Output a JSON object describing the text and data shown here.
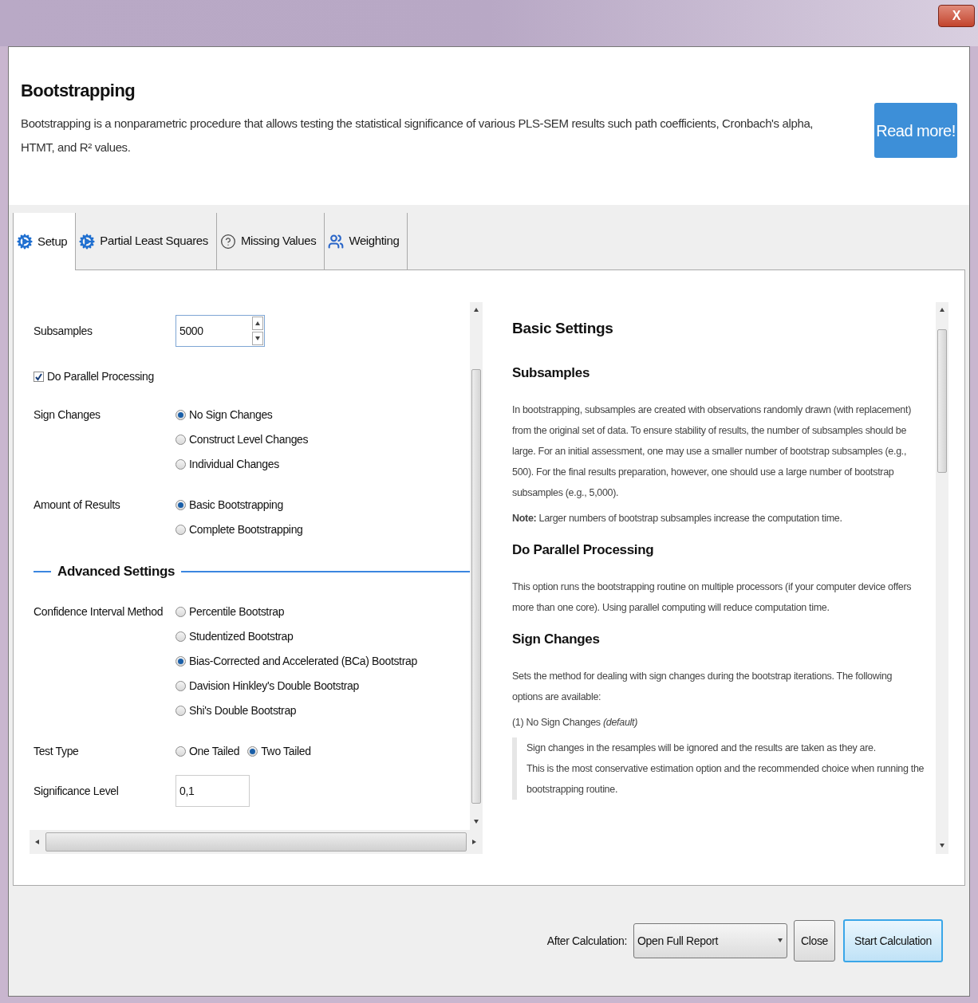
{
  "window": {
    "close_label": "X"
  },
  "header": {
    "title": "Bootstrapping",
    "description": "Bootstrapping is a nonparametric procedure that allows testing the statistical significance of various PLS-SEM results such path coefficients, Cronbach's alpha, HTMT, and R² values.",
    "read_more": "Read more!"
  },
  "tabs": [
    {
      "label": "Setup",
      "kind": "gear",
      "selected": true
    },
    {
      "label": "Partial Least Squares",
      "kind": "gear",
      "selected": false
    },
    {
      "label": "Missing Values",
      "kind": "help",
      "selected": false
    },
    {
      "label": "Weighting",
      "kind": "people",
      "selected": false
    }
  ],
  "setup": {
    "subsamples": {
      "label": "Subsamples",
      "value": "5000"
    },
    "parallel": {
      "label": "Do Parallel Processing",
      "checked": true
    },
    "sign_changes": {
      "label": "Sign Changes",
      "options": [
        {
          "label": "No Sign Changes",
          "selected": true
        },
        {
          "label": "Construct Level Changes",
          "selected": false
        },
        {
          "label": "Individual Changes",
          "selected": false
        }
      ]
    },
    "amount_of_results": {
      "label": "Amount of Results",
      "options": [
        {
          "label": "Basic Bootstrapping",
          "selected": true
        },
        {
          "label": "Complete Bootstrapping",
          "selected": false
        }
      ]
    },
    "advanced_title": "Advanced Settings",
    "confidence_interval": {
      "label": "Confidence Interval Method",
      "options": [
        {
          "label": "Percentile Bootstrap",
          "selected": false
        },
        {
          "label": "Studentized Bootstrap",
          "selected": false
        },
        {
          "label": "Bias-Corrected and Accelerated (BCa) Bootstrap",
          "selected": true
        },
        {
          "label": "Davision Hinkley's Double Bootstrap",
          "selected": false
        },
        {
          "label": "Shi's Double Bootstrap",
          "selected": false
        }
      ]
    },
    "test_type": {
      "label": "Test Type",
      "options": [
        {
          "label": "One Tailed",
          "selected": false
        },
        {
          "label": "Two Tailed",
          "selected": true
        }
      ]
    },
    "significance_level": {
      "label": "Significance Level",
      "value": "0,1"
    }
  },
  "help": [
    {
      "kind": "h1",
      "text": "Basic Settings"
    },
    {
      "kind": "h2",
      "text": "Subsamples"
    },
    {
      "kind": "p",
      "text": "In bootstrapping, subsamples are created with observations randomly drawn (with replacement) from the original set of data. To ensure stability of results, the number of subsamples should be large. For an initial assessment, one may use a smaller number of bootstrap subsamples (e.g., 500). For the final results preparation, however, one should use a large number of bootstrap subsamples (e.g., 5,000)."
    },
    {
      "kind": "p",
      "text": "**Note:** Larger numbers of bootstrap subsamples increase the computation time."
    },
    {
      "kind": "h2",
      "text": "Do Parallel Processing"
    },
    {
      "kind": "p",
      "text": "This option runs the bootstrapping routine on multiple processors (if your computer device offers more than one core). Using parallel computing will reduce computation time."
    },
    {
      "kind": "h2",
      "text": "Sign Changes"
    },
    {
      "kind": "p",
      "text": "Sets the method for dealing with sign changes during the bootstrap iterations. The following options are available:"
    },
    {
      "kind": "p",
      "text": "(1) No Sign Changes *(default)*"
    },
    {
      "kind": "quote",
      "text": "Sign changes in the resamples will be ignored and the results are taken as they are.\nThis is the most conservative estimation option and the recommended choice when running the bootstrapping routine."
    }
  ],
  "footer": {
    "after_label": "After Calculation:",
    "after_value": "Open Full Report",
    "close": "Close",
    "start": "Start Calculation"
  }
}
